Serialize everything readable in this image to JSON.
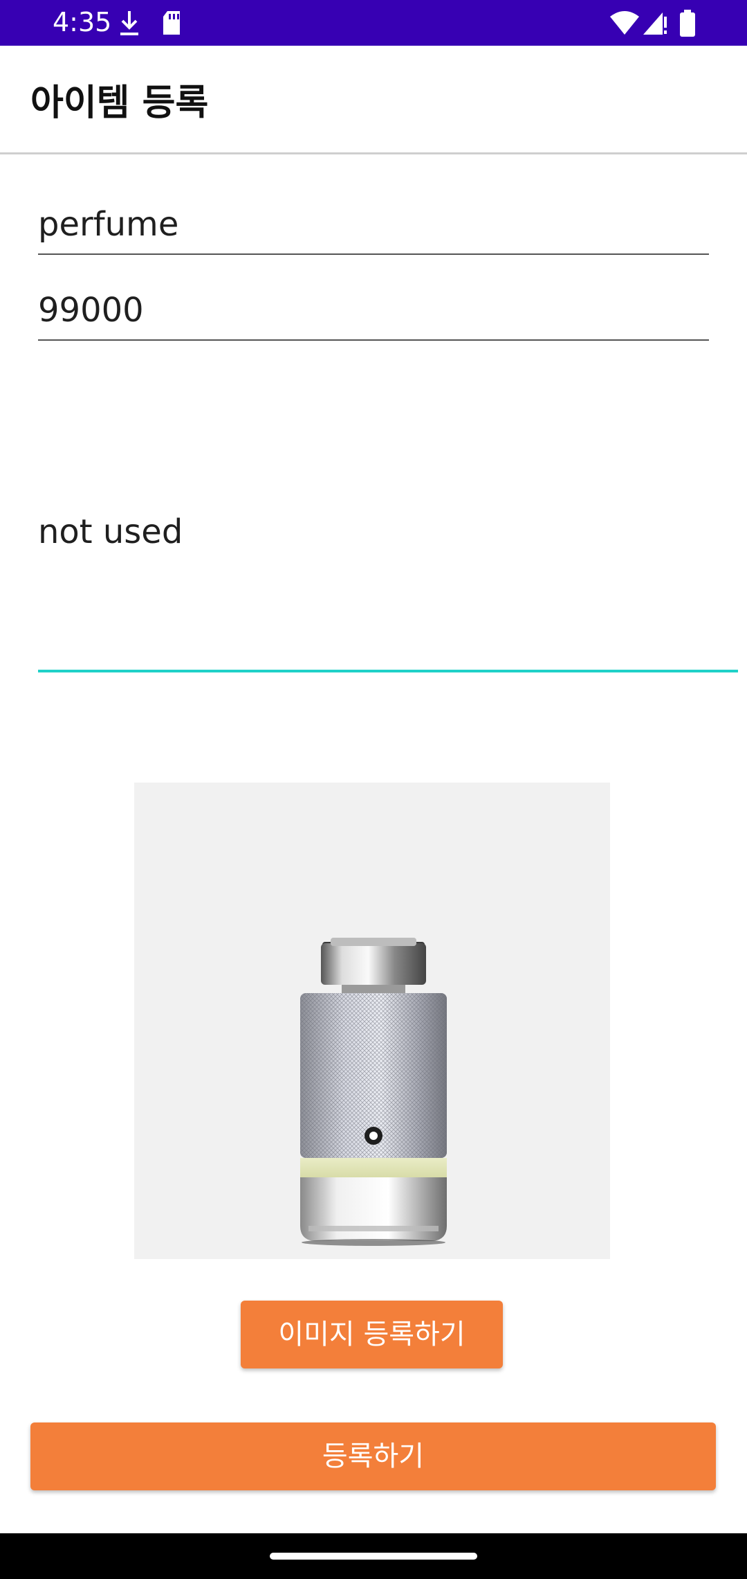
{
  "status_bar": {
    "time": "4:35",
    "icons": [
      "download-icon",
      "sd-card-icon",
      "wifi-icon",
      "signal-icon",
      "battery-icon"
    ]
  },
  "app_bar": {
    "title": "아이템 등록"
  },
  "form": {
    "name_value": "perfume",
    "price_value": "99000",
    "description_value": "not used"
  },
  "buttons": {
    "register_image_label": "이미지 등록하기",
    "register_label": "등록하기"
  },
  "colors": {
    "status_bar": "#3700b3",
    "accent": "#1fd1c8",
    "button": "#f37f3a"
  }
}
